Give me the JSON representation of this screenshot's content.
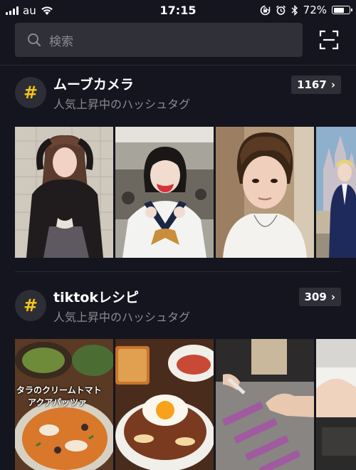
{
  "status_bar": {
    "carrier": "au",
    "time": "17:15",
    "battery": "72%",
    "battery_level": 0.72
  },
  "search": {
    "placeholder": "検索",
    "icon": "search-icon",
    "scan_icon": "scan-icon"
  },
  "sections": [
    {
      "title": "ムーブカメラ",
      "subtitle": "人気上昇中のハッシュタグ",
      "count": "1167"
    },
    {
      "title": "tiktokレシピ",
      "subtitle": "人気上昇中のハッシュタグ",
      "count": "309",
      "thumb_caption": [
        "タラのクリームトマト",
        "アクアパッツァ"
      ]
    }
  ],
  "colors": {
    "background": "#14151f",
    "hashtag_accent": "#f5c518",
    "search_bg": "#2f3038",
    "muted_text": "#8a8b91"
  }
}
